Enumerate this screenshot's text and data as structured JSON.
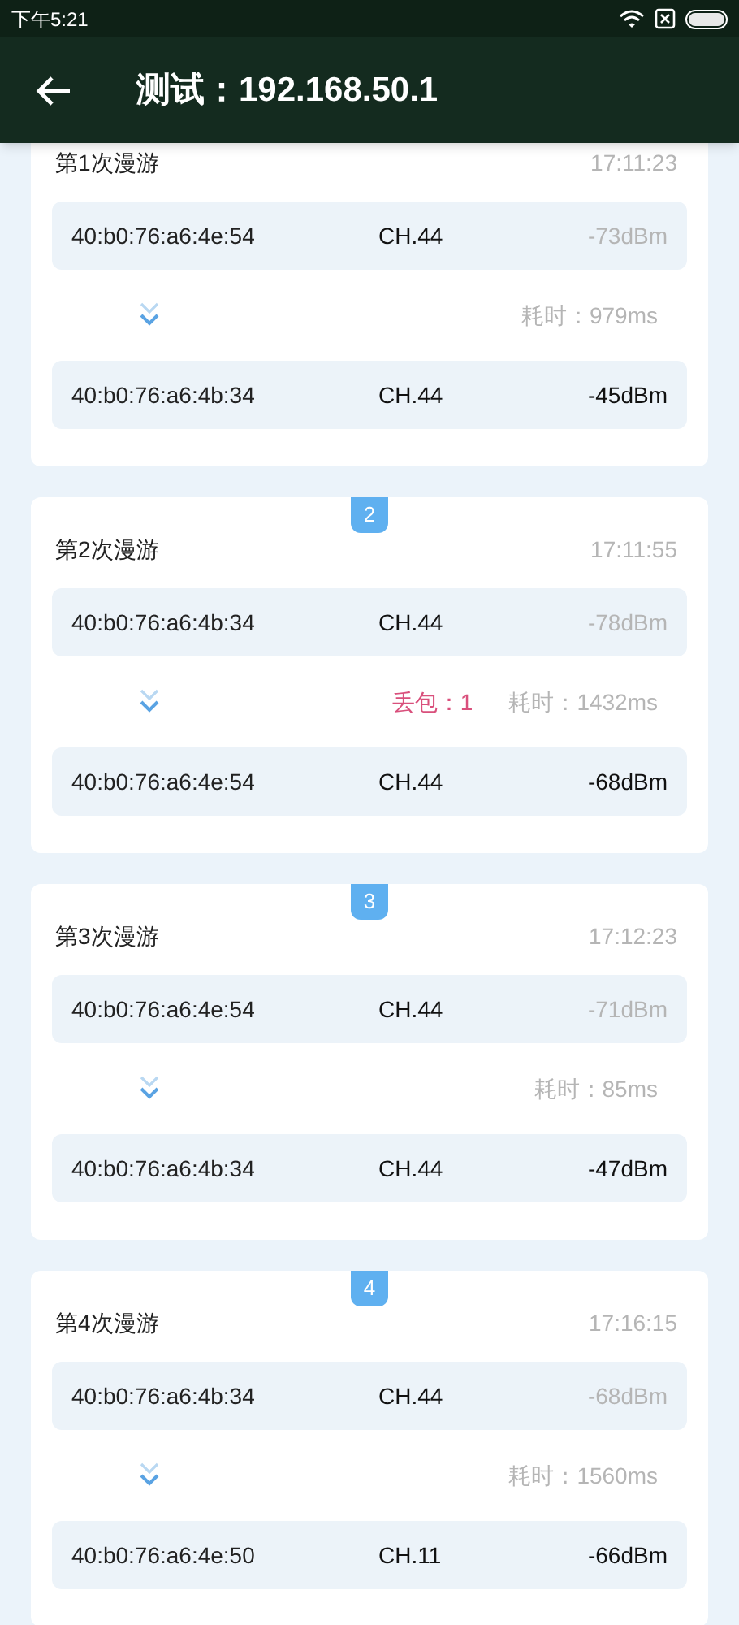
{
  "status_bar": {
    "time": "下午5:21"
  },
  "app_bar": {
    "title": "测试：192.168.50.1"
  },
  "roams": [
    {
      "title": "第1次漫游",
      "time": "17:11:23",
      "rows": [
        {
          "kind": "from",
          "mac": "40:b0:76:a6:4e:54",
          "channel": "CH.44",
          "signal": "-73dBm"
        },
        {
          "kind": "to",
          "mac": "40:b0:76:a6:4b:34",
          "channel": "CH.44",
          "signal": "-45dBm"
        }
      ],
      "duration": "耗时：979ms"
    },
    {
      "badge": "2",
      "title": "第2次漫游",
      "time": "17:11:55",
      "rows": [
        {
          "kind": "from",
          "mac": "40:b0:76:a6:4b:34",
          "channel": "CH.44",
          "signal": "-78dBm"
        },
        {
          "kind": "to",
          "mac": "40:b0:76:a6:4e:54",
          "channel": "CH.44",
          "signal": "-68dBm"
        }
      ],
      "loss": "丢包：1",
      "duration": "耗时：1432ms"
    },
    {
      "badge": "3",
      "title": "第3次漫游",
      "time": "17:12:23",
      "rows": [
        {
          "kind": "from",
          "mac": "40:b0:76:a6:4e:54",
          "channel": "CH.44",
          "signal": "-71dBm"
        },
        {
          "kind": "to",
          "mac": "40:b0:76:a6:4b:34",
          "channel": "CH.44",
          "signal": "-47dBm"
        }
      ],
      "duration": "耗时：85ms"
    },
    {
      "badge": "4",
      "title": "第4次漫游",
      "time": "17:16:15",
      "rows": [
        {
          "kind": "from",
          "mac": "40:b0:76:a6:4b:34",
          "channel": "CH.44",
          "signal": "-68dBm"
        },
        {
          "kind": "to",
          "mac": "40:b0:76:a6:4e:50",
          "channel": "CH.11",
          "signal": "-66dBm"
        }
      ],
      "duration": "耗时：1560ms"
    }
  ]
}
